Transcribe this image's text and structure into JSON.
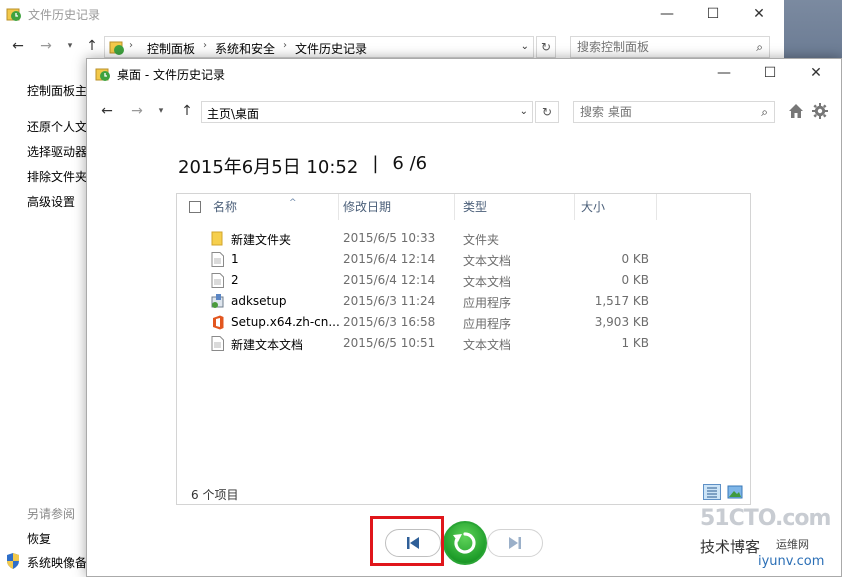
{
  "background_window": {
    "title": "文件历史记录",
    "breadcrumbs": [
      "控制面板",
      "系统和安全",
      "文件历史记录"
    ],
    "search_placeholder": "搜索控制面板",
    "sidebar": {
      "items": [
        "控制面板主页",
        "还原个人文件",
        "选择驱动器",
        "排除文件夹",
        "高级设置"
      ],
      "see_also_heading": "另请参阅",
      "see_also_items": [
        "恢复",
        "系统映像备份"
      ]
    }
  },
  "file_history_window": {
    "title": "桌面 - 文件历史记录",
    "address": "主页\\桌面",
    "search_placeholder": "搜索 桌面",
    "snapshot_datetime": "2015年6月5日 10:52",
    "snapshot_separator": "|",
    "snapshot_position": "6 /6",
    "columns": [
      "名称",
      "修改日期",
      "类型",
      "大小"
    ],
    "files": [
      {
        "name": "新建文件夹",
        "date": "2015/6/5 10:33",
        "type": "文件夹",
        "size": "",
        "icon": "folder-icon"
      },
      {
        "name": "1",
        "date": "2015/6/4 12:14",
        "type": "文本文档",
        "size": "0 KB",
        "icon": "text-file-icon"
      },
      {
        "name": "2",
        "date": "2015/6/4 12:14",
        "type": "文本文档",
        "size": "0 KB",
        "icon": "text-file-icon"
      },
      {
        "name": "adksetup",
        "date": "2015/6/3 11:24",
        "type": "应用程序",
        "size": "1,517 KB",
        "icon": "installer-icon"
      },
      {
        "name": "Setup.x64.zh-cn...",
        "date": "2015/6/3 16:58",
        "type": "应用程序",
        "size": "3,903 KB",
        "icon": "office-icon"
      },
      {
        "name": "新建文本文档",
        "date": "2015/6/5 10:51",
        "type": "文本文档",
        "size": "1 KB",
        "icon": "text-file-icon"
      }
    ],
    "status": "6 个项目"
  },
  "watermark": {
    "site": "51CTO.com",
    "line2": "技术博客",
    "line2_sub": "运维网",
    "line3": "iyunv.com"
  },
  "colors": {
    "highlight_border": "#e0161b",
    "restore_green": "#1f9e2a",
    "header_text": "#4c607a"
  }
}
